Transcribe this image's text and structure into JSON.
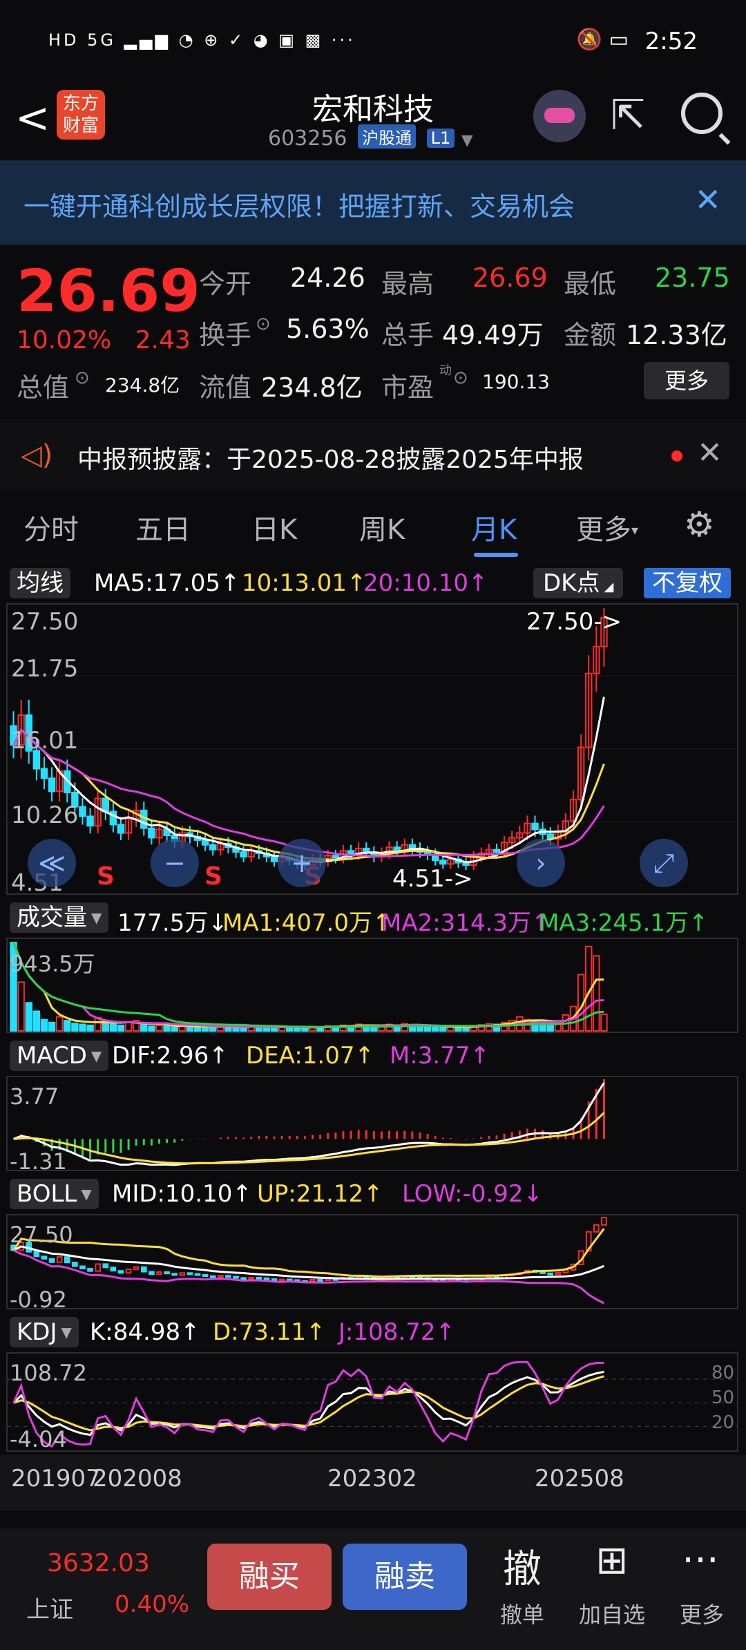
{
  "status": {
    "time": "2:52",
    "left_icons": "HD 5G ▂▄▆ ◔ ⊕ ✓ ◕ ▣ ▩ ···",
    "right_icons": "🔕 ▭"
  },
  "header": {
    "back": "<",
    "logo": "东方财富",
    "title": "宏和科技",
    "code": "603256",
    "tag1": "沪股通",
    "tag2": "L1"
  },
  "banner": {
    "text": "一键开通科创成长层权限！把握打新、交易机会",
    "close": "✕"
  },
  "quote": {
    "price": "26.69",
    "change_pct": "10.02%",
    "change_abs": "2.43",
    "open_label": "今开",
    "open": "24.26",
    "high_label": "最高",
    "high": "26.69",
    "low_label": "最低",
    "low": "23.75",
    "turnover_label": "换手",
    "turnover": "5.63%",
    "volume_label": "总手",
    "volume": "49.49万",
    "amount_label": "金额",
    "amount": "12.33亿",
    "mktcap_label": "总值",
    "mktcap": "234.8亿",
    "float_label": "流值",
    "float": "234.8亿",
    "pe_label": "市盈",
    "pe_sup": "动",
    "pe": "190.13",
    "more": "更多"
  },
  "notice": {
    "text": "中报预披露：于2025-08-28披露2025年中报",
    "close": "✕"
  },
  "tabs": [
    "分时",
    "五日",
    "日K",
    "周K",
    "月K",
    "更多"
  ],
  "tab_active": 4,
  "ma": {
    "btn": "均线",
    "ma5": "MA5:17.05↑",
    "ma10": "10:13.01↑",
    "ma20": "20:10.10↑",
    "dk": "DK点",
    "fq": "不复权"
  },
  "kline": {
    "y_labels": [
      "27.50",
      "21.75",
      "16.01",
      "10.26",
      "4.51"
    ],
    "hi_label": "27.50->",
    "lo_label": "4.51->",
    "s_marks": [
      "S",
      "S",
      "S"
    ]
  },
  "vol": {
    "btn": "成交量",
    "cur": "177.5万↓",
    "ma1": "MA1:407.0万↑",
    "ma2": "MA2:314.3万↑",
    "ma3": "MA3:245.1万↑",
    "y_label": "943.5万"
  },
  "macd": {
    "btn": "MACD",
    "dif": "DIF:2.96↑",
    "dea": "DEA:1.07↑",
    "m": "M:3.77↑",
    "y_top": "3.77",
    "y_bot": "-1.31"
  },
  "boll": {
    "btn": "BOLL",
    "mid": "MID:10.10↑",
    "up": "UP:21.12↑",
    "low": "LOW:-0.92↓",
    "y_top": "27.50",
    "y_bot": "-0.92"
  },
  "kdj": {
    "btn": "KDJ",
    "k": "K:84.98↑",
    "d": "D:73.11↑",
    "j": "J:108.72↑",
    "y_top": "108.72",
    "y_bot": "-4.04",
    "r80": "80",
    "r50": "50",
    "r20": "20"
  },
  "x_labels": [
    "201907",
    "202008",
    "202302",
    "202508"
  ],
  "bottom": {
    "index_value": "3632.03",
    "index_name": "上证",
    "index_pct": "0.40%",
    "buy": "融买",
    "sell": "融卖",
    "cancel_icon": "撤",
    "cancel": "撤单",
    "add_icon": "⊞",
    "add": "加自选",
    "more_icon": "···",
    "more": "更多"
  },
  "colors": {
    "up": "#ff2b2b",
    "down": "#22e0ff",
    "ma5": "#ffffff",
    "ma10": "#ffe033",
    "ma20": "#e03ce0",
    "accent": "#4d93ff"
  },
  "chart_data": {
    "type": "candlestick",
    "x_labels": [
      "201907",
      "202008",
      "202302",
      "202508"
    ],
    "ylim": [
      4.51,
      27.5
    ],
    "close": [
      16.0,
      18.5,
      15.5,
      14.0,
      13.2,
      12.1,
      13.8,
      12.0,
      10.8,
      10.0,
      9.2,
      11.5,
      10.4,
      9.3,
      8.6,
      9.8,
      10.5,
      9.0,
      8.2,
      8.9,
      8.4,
      7.9,
      8.6,
      8.3,
      8.0,
      7.6,
      7.2,
      7.7,
      7.4,
      7.0,
      6.6,
      7.1,
      6.9,
      6.6,
      6.2,
      6.5,
      6.3,
      6.0,
      5.9,
      6.4,
      6.2,
      6.7,
      6.5,
      7.1,
      6.8,
      7.3,
      7.0,
      6.6,
      6.9,
      7.4,
      7.1,
      7.6,
      7.3,
      7.0,
      6.8,
      6.3,
      6.0,
      6.4,
      6.1,
      5.9,
      6.6,
      6.9,
      7.2,
      7.0,
      7.8,
      8.2,
      8.6,
      9.4,
      8.9,
      8.5,
      8.1,
      8.7,
      9.6,
      11.4,
      15.8,
      22.0,
      24.26,
      26.69
    ],
    "volume": [
      943,
      520,
      300,
      210,
      120,
      90,
      150,
      110,
      80,
      70,
      60,
      140,
      100,
      80,
      60,
      90,
      110,
      70,
      50,
      60,
      55,
      40,
      60,
      50,
      45,
      40,
      35,
      55,
      45,
      40,
      35,
      50,
      45,
      40,
      35,
      45,
      40,
      35,
      30,
      45,
      40,
      55,
      50,
      60,
      55,
      70,
      60,
      50,
      55,
      70,
      60,
      75,
      65,
      55,
      50,
      40,
      35,
      45,
      40,
      35,
      55,
      65,
      75,
      70,
      90,
      110,
      150,
      120,
      95,
      85,
      80,
      110,
      170,
      260,
      600,
      900,
      800,
      177.5
    ],
    "ma5_last": 17.05,
    "ma10_last": 13.01,
    "ma20_last": 10.1
  }
}
